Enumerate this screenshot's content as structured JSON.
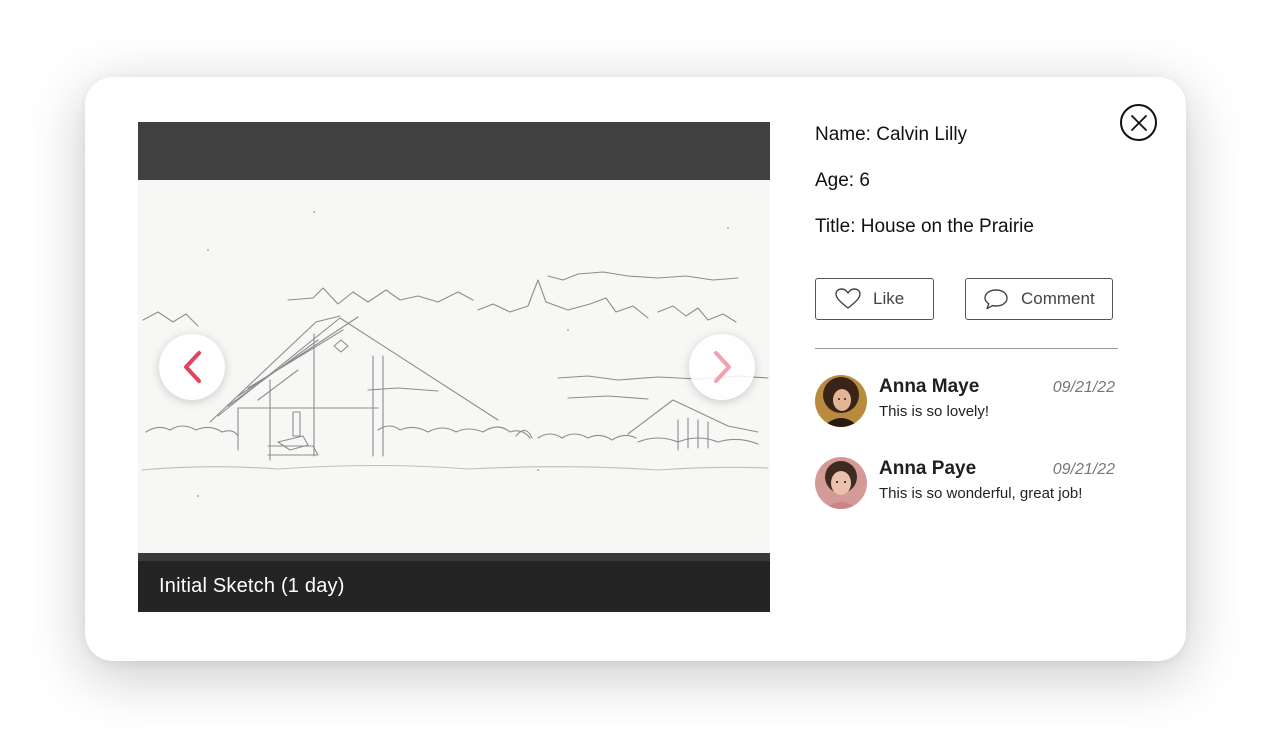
{
  "viewer": {
    "caption": "Initial Sketch (1 day)",
    "prev_icon": "chevron-left-icon",
    "next_icon": "chevron-right-icon"
  },
  "colors": {
    "accent": "#e0445f",
    "accent_light": "#f2a1ae",
    "topbar": "#414141",
    "caption_bar": "#242424"
  },
  "artwork": {
    "name": "Calvin Lilly",
    "name_line": "Name: Calvin Lilly",
    "age_line": "Age: 6",
    "title_line": "Title: House on the Prairie"
  },
  "actions": {
    "like_label": "Like",
    "like_icon": "heart-icon",
    "comment_label": "Comment",
    "comment_icon": "speech-bubble-icon"
  },
  "close_icon": "close-icon",
  "comments": [
    {
      "author": "Anna Maye",
      "date": "09/21/22",
      "text": "This is so lovely!"
    },
    {
      "author": "Anna Paye",
      "date": "09/21/22",
      "text": "This is so wonderful, great job!"
    }
  ]
}
